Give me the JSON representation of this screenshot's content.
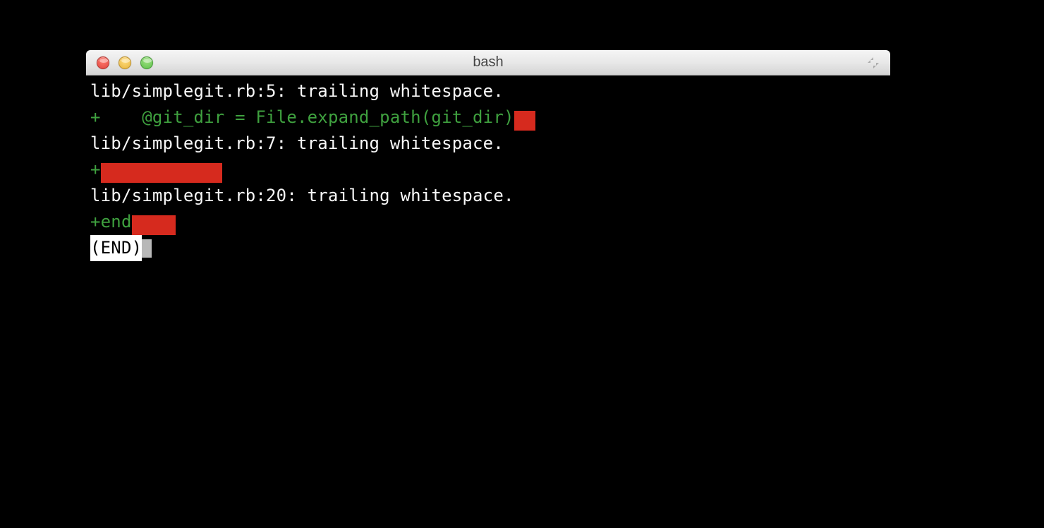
{
  "window": {
    "title": "bash"
  },
  "terminal": {
    "lines": [
      {
        "type": "msg",
        "text": "lib/simplegit.rb:5: trailing whitespace."
      },
      {
        "type": "diff",
        "plus": "+",
        "content": "    @git_dir = File.expand_path(git_dir)",
        "ws_class": "ws1"
      },
      {
        "type": "msg",
        "text": "lib/simplegit.rb:7: trailing whitespace."
      },
      {
        "type": "diff",
        "plus": "+",
        "content": "",
        "ws_class": "ws2"
      },
      {
        "type": "msg",
        "text": "lib/simplegit.rb:20: trailing whitespace."
      },
      {
        "type": "diff",
        "plus": "+",
        "content": "end",
        "ws_class": "ws3"
      }
    ],
    "end_marker": "(END)"
  }
}
